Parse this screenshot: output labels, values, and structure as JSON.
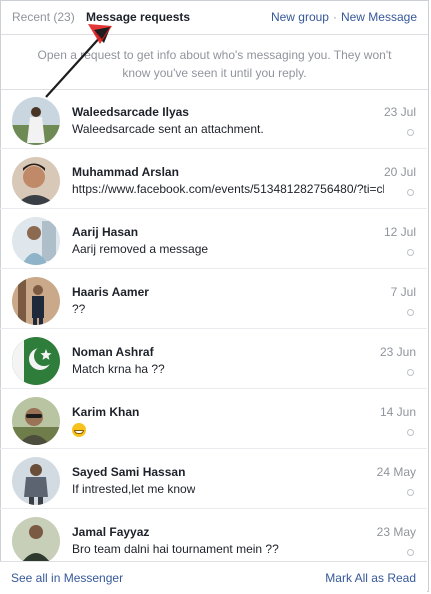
{
  "header": {
    "recent_label": "Recent (23)",
    "requests_label": "Message requests",
    "new_group_label": "New group",
    "separator": "·",
    "new_message_label": "New Message"
  },
  "notice": "Open a request to get info about who's messaging you. They won't know you've seen it until you reply.",
  "requests": [
    {
      "name": "Waleedsarcade Ilyas",
      "snippet": "Waleedsarcade sent an attachment.",
      "date": "23 Jul",
      "avatar_bg": "#8aa3b8"
    },
    {
      "name": "Muhammad Arslan",
      "snippet": "https://www.facebook.com/events/513481282756480/?ti=cl",
      "date": "20 Jul",
      "avatar_bg": "#b08a6b"
    },
    {
      "name": "Aarij Hasan",
      "snippet": "Aarij removed a message",
      "date": "12 Jul",
      "avatar_bg": "#9fb4c4"
    },
    {
      "name": "Haaris Aamer",
      "snippet": "??",
      "date": "7 Jul",
      "avatar_bg": "#a58b70"
    },
    {
      "name": "Noman Ashraf",
      "snippet": "Match krna ha ??",
      "date": "23 Jun",
      "avatar_bg": "#2e7d32"
    },
    {
      "name": "Karim Khan",
      "snippet": "",
      "snippet_icon": "grinning-emoji",
      "date": "14 Jun",
      "avatar_bg": "#7a8f5a"
    },
    {
      "name": "Sayed Sami Hassan",
      "snippet": "If intrested,let me know",
      "date": "24 May",
      "avatar_bg": "#9aa7b3"
    },
    {
      "name": "Jamal Fayyaz",
      "snippet": "Bro team dalni hai tournament mein ??",
      "date": "23 May",
      "avatar_bg": "#8d9c7a"
    }
  ],
  "footer": {
    "see_all_label": "See all in Messenger",
    "mark_all_label": "Mark All as Read"
  },
  "colors": {
    "link": "#365899",
    "muted": "#90949c",
    "annotation_arrow": "#1d1d1d"
  }
}
